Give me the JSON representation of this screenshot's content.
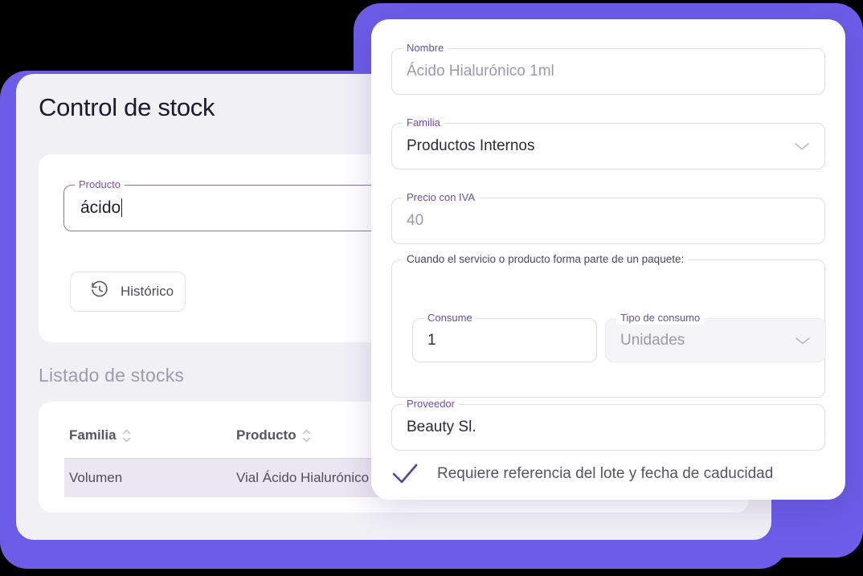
{
  "theme": {
    "accent_purple": "#6c5ce7",
    "label_purple": "#6d4f9c",
    "focus_purple": "#8a6fb5",
    "check_purple": "#5b3fa8",
    "window_bg": "#f1f0f5",
    "card_bg": "#ffffff",
    "row_highlight": "#eae6f2"
  },
  "left_window": {
    "title": "Control de stock",
    "search_card": {
      "producto_field": {
        "legend": "Producto",
        "value": "ácido",
        "placeholder": "Producto",
        "focused": true
      },
      "historico_button": {
        "label": "Histórico",
        "icon": "history-icon"
      }
    },
    "listado": {
      "title": "Listado de stocks",
      "table": {
        "columns": [
          {
            "label": "Familia",
            "sortable": true,
            "sort_icon": "sort-updown-icon"
          },
          {
            "label": "Producto",
            "sortable": true,
            "sort_icon": "sort-updown-icon"
          }
        ],
        "rows": [
          {
            "familia": "Volumen",
            "producto": "Vial Ácido Hialurónico",
            "selected": true
          }
        ]
      }
    }
  },
  "right_card": {
    "fields": {
      "nombre": {
        "legend": "Nombre",
        "value": "Ácido Hialurónico 1ml",
        "placeholder": "Nombre"
      },
      "familia": {
        "legend": "Familia",
        "value": "Productos Internos",
        "chevron": "chevron-down-icon"
      },
      "precio": {
        "legend": "Precio con IVA",
        "value": "40",
        "placeholder": "Precio con IVA"
      },
      "paquete_group": {
        "legend": "Cuando el servicio o producto forma parte de un paquete:",
        "consume": {
          "legend": "Consume",
          "value": "1"
        },
        "tipo_consumo": {
          "legend": "Tipo de consumo",
          "value": "Unidades",
          "chevron": "chevron-down-icon"
        }
      },
      "proveedor": {
        "legend": "Proveedor",
        "value": "Beauty Sl."
      }
    },
    "requiere_checkbox": {
      "label": "Requiere referencia del lote y fecha de caducidad",
      "checked": true,
      "icon": "check-icon"
    }
  }
}
